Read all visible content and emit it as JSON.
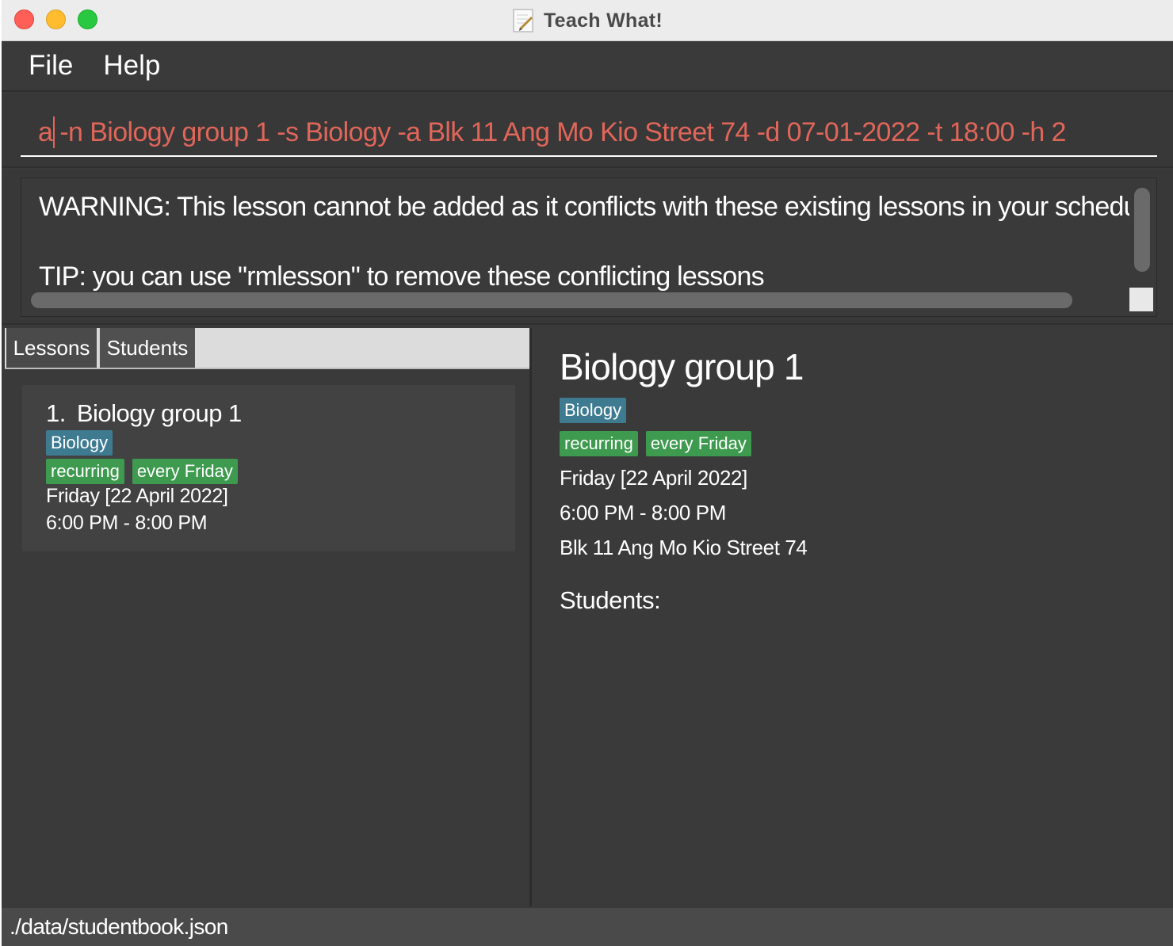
{
  "window": {
    "title": "Teach What!"
  },
  "menu": {
    "file": "File",
    "help": "Help"
  },
  "command": {
    "before_caret": "a",
    "after_caret": " -n Biology group 1 -s Biology -a Blk 11 Ang Mo Kio Street 74 -d 07-01-2022 -t 18:00 -h 2"
  },
  "result": {
    "warning": "WARNING: This lesson cannot be added as it conflicts with these existing lessons in your schedule",
    "tip": "TIP: you can use \"rmlesson\" to remove these conflicting lessons"
  },
  "tabs": {
    "lessons": "Lessons",
    "students": "Students"
  },
  "lesson_list": [
    {
      "index": "1.",
      "name": "Biology group 1",
      "subject": "Biology",
      "tags": [
        "recurring",
        "every Friday"
      ],
      "date": "Friday [22 April 2022]",
      "time": "6:00 PM - 8:00 PM"
    }
  ],
  "detail": {
    "name": "Biology group 1",
    "subject": "Biology",
    "tags": [
      "recurring",
      "every Friday"
    ],
    "date": "Friday [22 April 2022]",
    "time": "6:00 PM - 8:00 PM",
    "address": "Blk 11 Ang Mo Kio Street 74",
    "students_label": "Students:"
  },
  "status": {
    "file_path": "./data/studentbook.json"
  },
  "colors": {
    "background": "#3a3a3a",
    "command_text": "#e06659",
    "subject_tag": "#3e7b91",
    "green_tag": "#3e9a4f"
  }
}
